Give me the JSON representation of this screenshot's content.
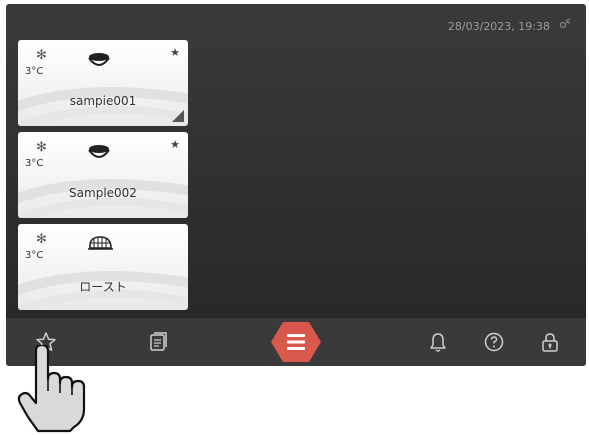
{
  "status": {
    "datetime": "28/03/2023, 19:38"
  },
  "recipes": [
    {
      "temp": "3°C",
      "name": "sampie001",
      "mode_icon": "snowflake-icon",
      "food_icon": "bowl-icon",
      "favorite": true,
      "selected_corner": true
    },
    {
      "temp": "3°C",
      "name": "Sample002",
      "mode_icon": "snowflake-icon",
      "food_icon": "bowl-icon",
      "favorite": true,
      "selected_corner": false
    },
    {
      "temp": "3°C",
      "name": "ロースト",
      "mode_icon": "snowflake-icon",
      "food_icon": "roast-icon",
      "favorite": false,
      "selected_corner": false
    }
  ],
  "toolbar": {
    "items": [
      {
        "icon": "star-outline-icon"
      },
      {
        "icon": "recipe-book-icon"
      },
      {
        "icon": "menu-icon"
      },
      {
        "icon": "bell-icon"
      },
      {
        "icon": "help-icon"
      },
      {
        "icon": "lock-icon"
      }
    ]
  },
  "colors": {
    "background": "#2f2f2f",
    "card": "#f3f3f3",
    "menu_hex": "#d8594b",
    "text_dim": "#9a9a9a"
  }
}
